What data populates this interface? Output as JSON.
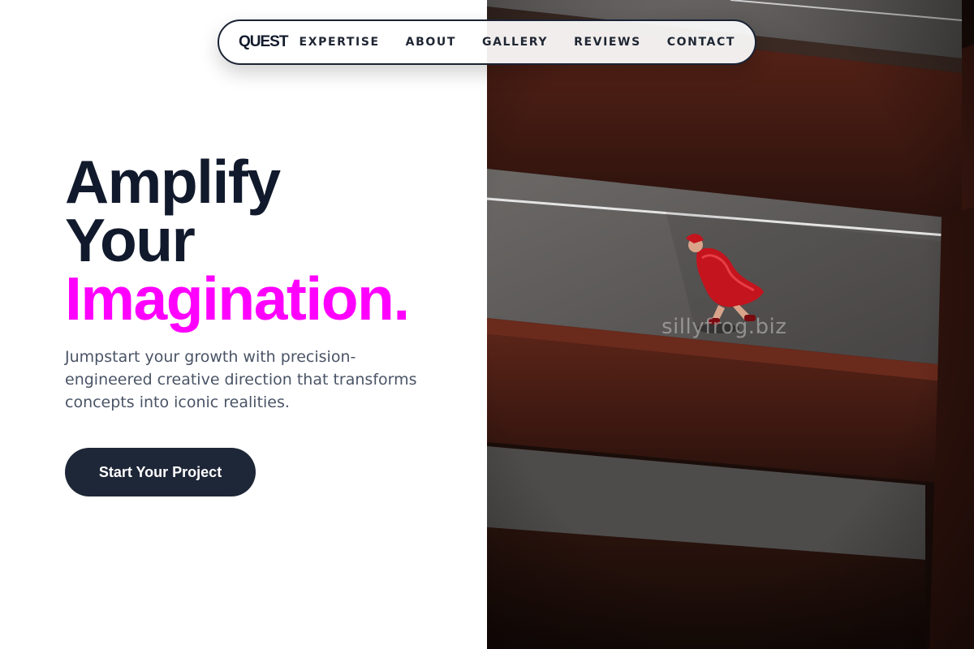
{
  "nav": {
    "brand": "QUEST",
    "links": [
      {
        "label": "EXPERTISE"
      },
      {
        "label": "ABOUT"
      },
      {
        "label": "GALLERY"
      },
      {
        "label": "REVIEWS"
      },
      {
        "label": "CONTACT"
      }
    ]
  },
  "hero": {
    "title_line1": "Amplify",
    "title_line2": "Your",
    "title_line3": "Imagination.",
    "subtitle": "Jumpstart your growth with precision-engineered creative direction that transforms concepts into iconic realities.",
    "cta_label": "Start Your Project"
  },
  "photo": {
    "watermark": "sillyfrog.biz"
  },
  "colors": {
    "accent": "#ff00ff",
    "ink": "#111a2c",
    "cta_bg": "#1e2738",
    "body_text": "#4a5466"
  }
}
